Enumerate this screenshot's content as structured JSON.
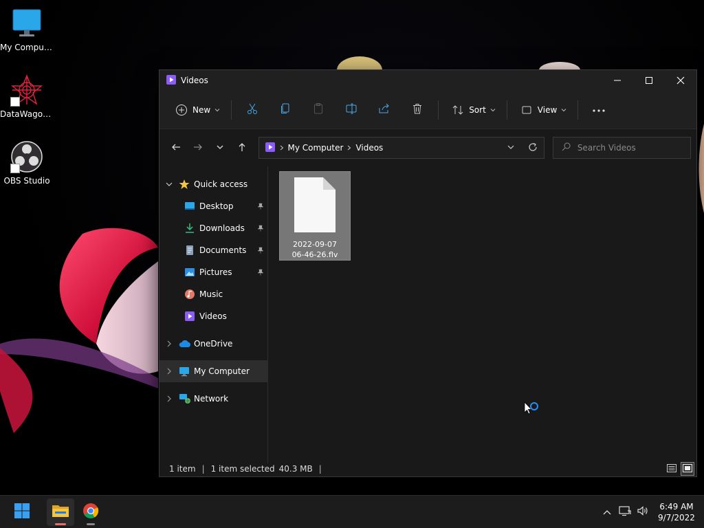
{
  "desktop": {
    "icons": [
      {
        "label": "My Computer"
      },
      {
        "label": "DataWagon..."
      },
      {
        "label": "OBS Studio"
      }
    ]
  },
  "window": {
    "title": "Videos",
    "toolbar": {
      "new_label": "New",
      "sort_label": "Sort",
      "view_label": "View"
    },
    "address": {
      "crumbs": [
        "My Computer",
        "Videos"
      ],
      "search_placeholder": "Search Videos"
    },
    "nav": {
      "quick_access": "Quick access",
      "items": [
        {
          "label": "Desktop",
          "pinned": true
        },
        {
          "label": "Downloads",
          "pinned": true
        },
        {
          "label": "Documents",
          "pinned": true
        },
        {
          "label": "Pictures",
          "pinned": true
        },
        {
          "label": "Music",
          "pinned": false
        },
        {
          "label": "Videos",
          "pinned": false
        }
      ],
      "onedrive": "OneDrive",
      "my_computer": "My Computer",
      "network": "Network"
    },
    "files": [
      {
        "name_line1": "2022-09-07",
        "name_line2": "06-46-26.flv"
      }
    ],
    "status": {
      "count": "1 item",
      "selected": "1 item selected",
      "size": "40.3 MB"
    }
  },
  "taskbar": {
    "time": "6:49 AM",
    "date": "9/7/2022"
  },
  "colors": {
    "accent": "#0078d4",
    "folder_yellow": "#f4c542",
    "video_purple": "#8b5cf6",
    "window_bg": "#191919"
  }
}
